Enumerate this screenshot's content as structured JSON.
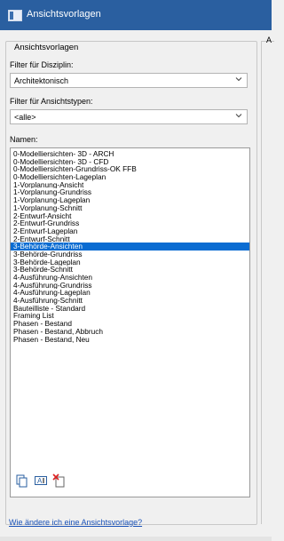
{
  "window": {
    "title": "Ansichtsvorlagen"
  },
  "left_panel": {
    "group_title": "Ansichtsvorlagen",
    "discipline_filter": {
      "label": "Filter für Disziplin:",
      "value": "Architektonisch"
    },
    "viewtype_filter": {
      "label": "Filter für Ansichtstypen:",
      "value": "<alle>"
    },
    "names_label": "Namen:",
    "names": [
      "0-Modelliersichten- 3D - ARCH",
      "0-Modelliersichten- 3D - CFD",
      "0-Modelliersichten-Grundriss-OK FFB",
      "0-Modelliersichten-Lageplan",
      "1-Vorplanung-Ansicht",
      "1-Vorplanung-Grundriss",
      "1-Vorplanung-Lageplan",
      "1-Vorplanung-Schnitt",
      "2-Entwurf-Ansicht",
      "2-Entwurf-Grundriss",
      "2-Entwurf-Lageplan",
      "2-Entwurf-Schnitt",
      "3-Behörde-Ansichten",
      "3-Behörde-Grundriss",
      "3-Behörde-Lageplan",
      "3-Behörde-Schnitt",
      "4-Ausführung-Ansichten",
      "4-Ausführung-Grundriss",
      "4-Ausführung-Lageplan",
      "4-Ausführung-Schnitt",
      "Bauteilliste - Standard",
      "Framing List",
      "Phasen - Bestand",
      "Phasen - Bestand, Abbruch",
      "Phasen - Bestand, Neu"
    ],
    "selected_index": 12,
    "toolbar_icons": [
      "duplicate-icon",
      "rename-icon",
      "delete-icon"
    ],
    "help_link": "Wie ändere ich eine Ansichtsvorlage?"
  },
  "right_panel": {
    "partial_label": "A"
  },
  "colors": {
    "titlebar": "#2a5fa0",
    "selection": "#0a6cd2",
    "link": "#1a52b8"
  }
}
